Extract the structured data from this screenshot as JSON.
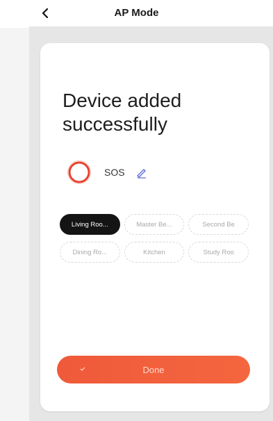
{
  "header": {
    "title": "AP Mode",
    "back_icon": "chevron-left-icon"
  },
  "card": {
    "headline_line1": "Device added",
    "headline_line2": "successfully",
    "device": {
      "name": "SOS",
      "icon": "ring-icon",
      "icon_color": "#e8412e",
      "edit_icon": "pencil-icon"
    },
    "rooms": [
      {
        "label": "Living Roo...",
        "selected": true
      },
      {
        "label": "Master Be...",
        "selected": false
      },
      {
        "label": "Second Be",
        "selected": false
      },
      {
        "label": "Dining Ro...",
        "selected": false
      },
      {
        "label": "Kitchen",
        "selected": false
      },
      {
        "label": "Study Roo",
        "selected": false
      }
    ],
    "done_label": "Done",
    "done_color": "#f05a3b"
  }
}
